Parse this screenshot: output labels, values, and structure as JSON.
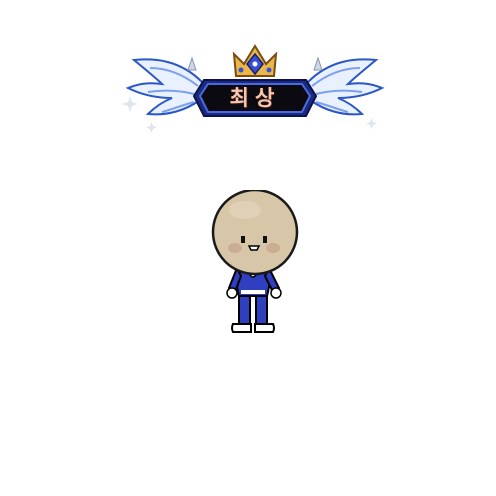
{
  "badge": {
    "label": "최상",
    "icon": "winged-crown-emblem",
    "accent_color": "#2a56c6",
    "text_color": "#f3c7b3"
  },
  "character": {
    "icon": "round-head-avatar",
    "outfit_color": "#2f3fc0",
    "head_color": "#d8c6a8"
  }
}
